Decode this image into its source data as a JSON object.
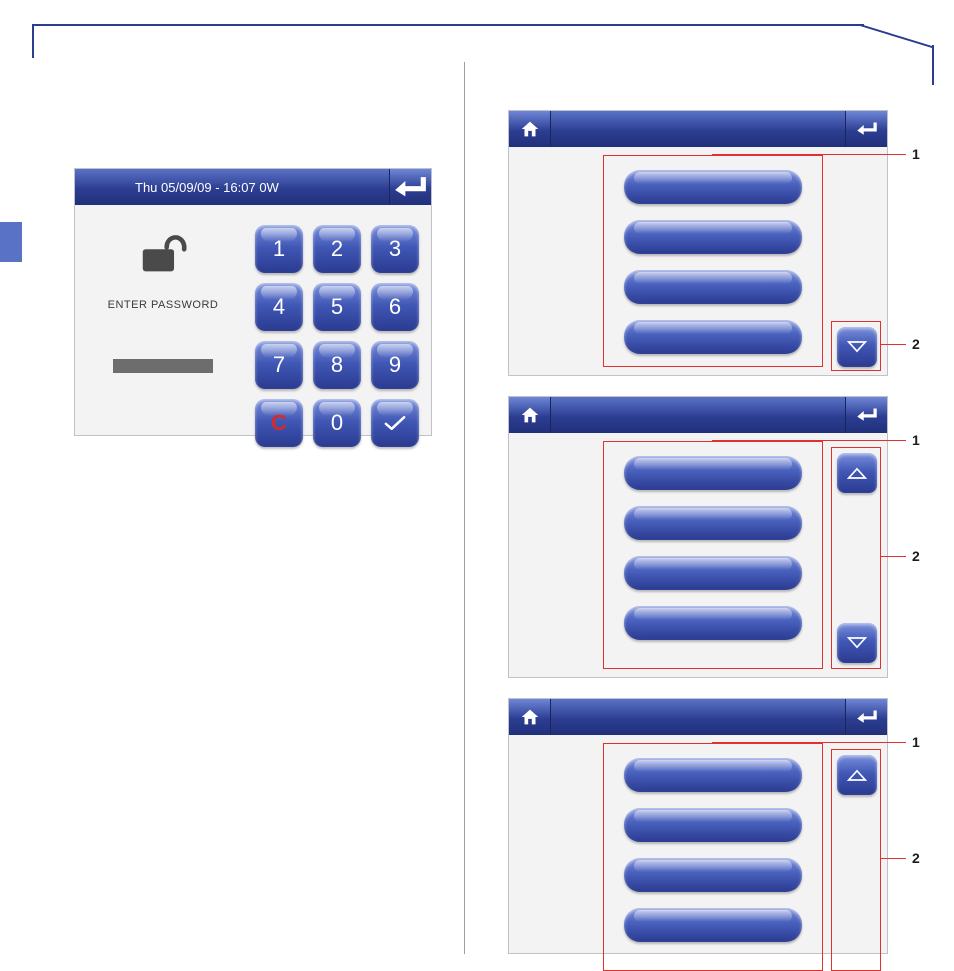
{
  "password_panel": {
    "header_text": "Thu 05/09/09 - 16:07   0W",
    "prompt": "ENTER PASSWORD",
    "keys": {
      "k1": "1",
      "k2": "2",
      "k3": "3",
      "k4": "4",
      "k5": "5",
      "k6": "6",
      "k7": "7",
      "k8": "8",
      "k9": "9",
      "clear": "C",
      "k0": "0"
    }
  },
  "menu_panels": {
    "panel1": {
      "callout_items": "1",
      "callout_scroll": "2",
      "item_count": 4
    },
    "panel2": {
      "callout_items": "1",
      "callout_scroll": "2",
      "item_count": 4
    },
    "panel3": {
      "callout_items": "1",
      "callout_scroll": "2",
      "item_count": 4
    }
  },
  "colors": {
    "brand_blue": "#2c3e92",
    "callout_red": "#e03030"
  }
}
